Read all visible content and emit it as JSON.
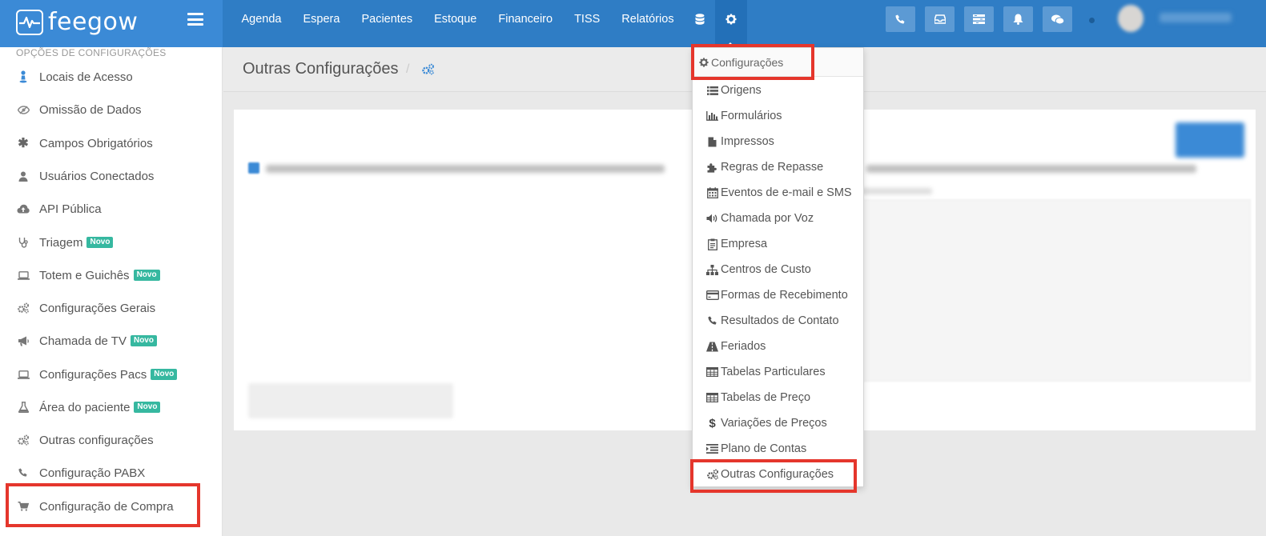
{
  "brand": {
    "name": "feegow"
  },
  "nav": {
    "items": [
      "Agenda",
      "Espera",
      "Pacientes",
      "Estoque",
      "Financeiro",
      "TISS",
      "Relatórios"
    ],
    "db_icon": "database-icon",
    "settings_icon": "gear-icon"
  },
  "top_right_icons": [
    "phone-icon",
    "inbox-icon",
    "list-icon",
    "bell-icon",
    "chat-icon"
  ],
  "sidebar": {
    "title": "OPÇÕES DE CONFIGURAÇÕES",
    "items": [
      {
        "label": "Locais de Acesso",
        "icon": "location-icon",
        "badge": ""
      },
      {
        "label": "Omissão de Dados",
        "icon": "eye-slash-icon",
        "badge": ""
      },
      {
        "label": "Campos Obrigatórios",
        "icon": "asterisk-icon",
        "badge": ""
      },
      {
        "label": "Usuários Conectados",
        "icon": "user-icon",
        "badge": ""
      },
      {
        "label": "API Pública",
        "icon": "cloud-upload-icon",
        "badge": ""
      },
      {
        "label": "Triagem",
        "icon": "stethoscope-icon",
        "badge": "Novo"
      },
      {
        "label": "Totem e Guichês",
        "icon": "laptop-icon",
        "badge": "Novo"
      },
      {
        "label": "Configurações Gerais",
        "icon": "gears-icon",
        "badge": ""
      },
      {
        "label": "Chamada de TV",
        "icon": "bullhorn-icon",
        "badge": "Novo"
      },
      {
        "label": "Configurações Pacs",
        "icon": "laptop-icon",
        "badge": "Novo"
      },
      {
        "label": "Área do paciente",
        "icon": "flask-icon",
        "badge": "Novo"
      },
      {
        "label": "Outras configurações",
        "icon": "gears-icon",
        "badge": ""
      },
      {
        "label": "Configuração PABX",
        "icon": "phone-icon",
        "badge": ""
      },
      {
        "label": "Configuração de Compra",
        "icon": "cart-icon",
        "badge": ""
      }
    ]
  },
  "page": {
    "title": "Outras Configurações",
    "crumb_sep": "/"
  },
  "dropdown": {
    "header": "Configurações",
    "items": [
      {
        "label": "Origens",
        "icon": "list-icon"
      },
      {
        "label": "Formulários",
        "icon": "bar-chart-icon"
      },
      {
        "label": "Impressos",
        "icon": "file-icon"
      },
      {
        "label": "Regras de Repasse",
        "icon": "puzzle-icon"
      },
      {
        "label": "Eventos de e-mail e SMS",
        "icon": "calendar-icon"
      },
      {
        "label": "Chamada por Voz",
        "icon": "volume-icon"
      },
      {
        "label": "Empresa",
        "icon": "clipboard-icon"
      },
      {
        "label": "Centros de Custo",
        "icon": "sitemap-icon"
      },
      {
        "label": "Formas de Recebimento",
        "icon": "credit-card-icon"
      },
      {
        "label": "Resultados de Contato",
        "icon": "phone-icon"
      },
      {
        "label": "Feriados",
        "icon": "road-icon"
      },
      {
        "label": "Tabelas Particulares",
        "icon": "table-icon"
      },
      {
        "label": "Tabelas de Preço",
        "icon": "table-icon"
      },
      {
        "label": "Variações de Preços",
        "icon": "dollar-icon"
      },
      {
        "label": "Plano de Contas",
        "icon": "indent-icon"
      },
      {
        "label": "Outras Configurações",
        "icon": "gears-icon"
      }
    ]
  },
  "colors": {
    "topbar": "#2f7dc5",
    "brand": "#3b8ad6",
    "highlight": "#e5362c",
    "badge": "#36b8a0"
  }
}
